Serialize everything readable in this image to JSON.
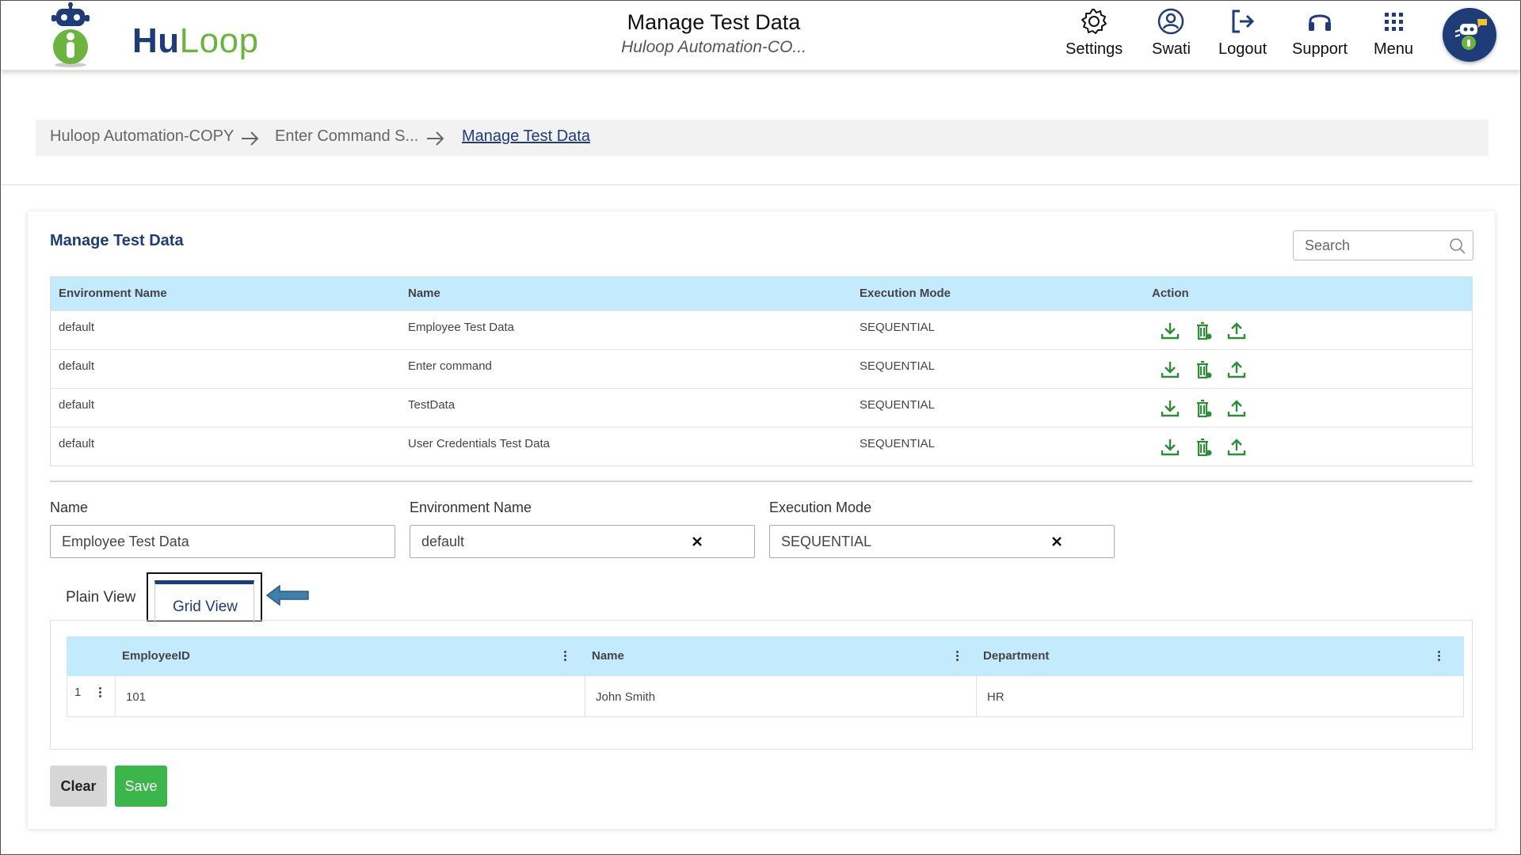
{
  "header": {
    "logo": {
      "hu": "Hu",
      "loop": "Loop"
    },
    "title": "Manage Test Data",
    "subtitle": "Huloop Automation-CO...",
    "nav": [
      {
        "label": "Settings",
        "icon": "gear-icon"
      },
      {
        "label": "Swati",
        "icon": "user-icon"
      },
      {
        "label": "Logout",
        "icon": "logout-icon"
      },
      {
        "label": "Support",
        "icon": "headset-icon"
      },
      {
        "label": "Menu",
        "icon": "grid-menu-icon"
      }
    ]
  },
  "breadcrumb": [
    {
      "label": "Huloop Automation-COPY"
    },
    {
      "label": "Enter Command S..."
    },
    {
      "label": "Manage Test Data"
    }
  ],
  "card": {
    "title": "Manage Test Data",
    "search_placeholder": "Search"
  },
  "table": {
    "columns": [
      "Environment Name",
      "Name",
      "Execution Mode",
      "Action"
    ],
    "rows": [
      {
        "env": "default",
        "name": "Employee Test Data",
        "mode": "SEQUENTIAL"
      },
      {
        "env": "default",
        "name": "Enter command",
        "mode": "SEQUENTIAL"
      },
      {
        "env": "default",
        "name": "TestData",
        "mode": "SEQUENTIAL"
      },
      {
        "env": "default",
        "name": "User Credentials Test Data",
        "mode": "SEQUENTIAL"
      }
    ],
    "actions": [
      "download-icon",
      "delete-icon",
      "upload-icon"
    ]
  },
  "form": {
    "name_label": "Name",
    "name_value": "Employee Test Data",
    "env_label": "Environment Name",
    "env_value": "default",
    "mode_label": "Execution Mode",
    "mode_value": "SEQUENTIAL"
  },
  "tabs": {
    "plain": "Plain View",
    "grid": "Grid View"
  },
  "grid": {
    "columns": [
      "EmployeeID",
      "Name",
      "Department"
    ],
    "rows": [
      {
        "index": "1",
        "employee_id": "101",
        "name": "John Smith",
        "department": "HR"
      }
    ]
  },
  "buttons": {
    "clear": "Clear",
    "save": "Save"
  },
  "colors": {
    "brand_blue": "#1d3c78",
    "brand_green": "#6cb33f",
    "header_bg": "#c4eafd",
    "save_green": "#3cb54a"
  }
}
